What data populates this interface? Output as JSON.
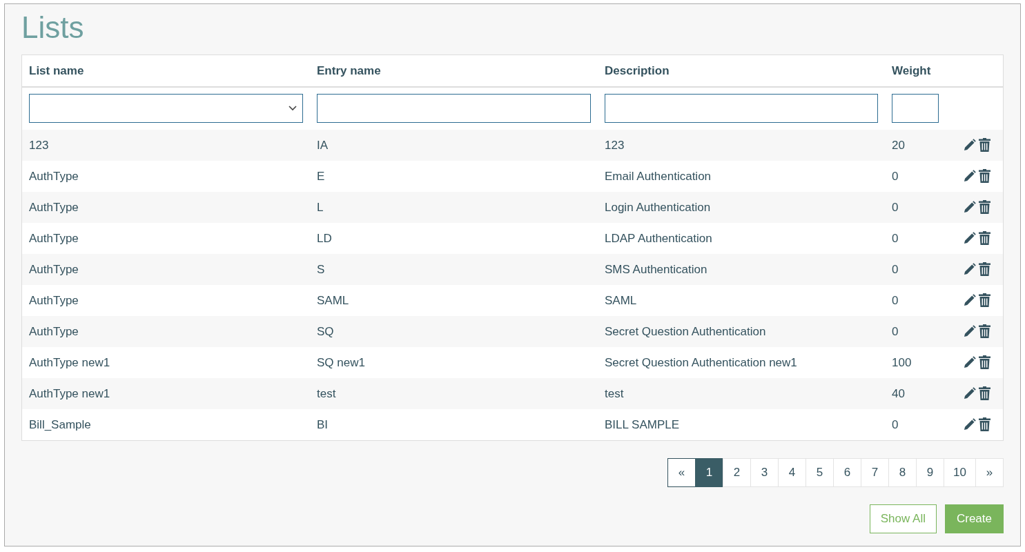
{
  "title": "Lists",
  "table": {
    "columns": [
      "List name",
      "Entry name",
      "Description",
      "Weight"
    ],
    "filters": [
      {
        "kind": "select"
      },
      {
        "kind": "text"
      },
      {
        "kind": "text"
      },
      {
        "kind": "number"
      }
    ],
    "rows": [
      {
        "cells": [
          "123",
          "IA",
          "123",
          "20"
        ]
      },
      {
        "cells": [
          "AuthType",
          "E",
          "Email Authentication",
          "0"
        ]
      },
      {
        "cells": [
          "AuthType",
          "L",
          "Login Authentication",
          "0"
        ]
      },
      {
        "cells": [
          "AuthType",
          "LD",
          "LDAP Authentication",
          "0"
        ]
      },
      {
        "cells": [
          "AuthType",
          "S",
          "SMS Authentication",
          "0"
        ]
      },
      {
        "cells": [
          "AuthType",
          "SAML",
          "SAML",
          "0"
        ]
      },
      {
        "cells": [
          "AuthType",
          "SQ",
          "Secret Question Authentication",
          "0"
        ]
      },
      {
        "cells": [
          "AuthType new1",
          "SQ new1",
          "Secret Question Authentication new1",
          "100"
        ]
      },
      {
        "cells": [
          "AuthType new1",
          "test",
          "test",
          "40"
        ]
      },
      {
        "cells": [
          "Bill_Sample",
          "BI",
          "BILL SAMPLE",
          "0"
        ]
      }
    ]
  },
  "pagination": {
    "previous": "«",
    "next": "»",
    "pages": [
      {
        "label": "1",
        "selected": true
      },
      {
        "label": "2",
        "selected": false
      },
      {
        "label": "3",
        "selected": false
      },
      {
        "label": "4",
        "selected": false
      },
      {
        "label": "5",
        "selected": false
      },
      {
        "label": "6",
        "selected": false
      },
      {
        "label": "7",
        "selected": false
      },
      {
        "label": "8",
        "selected": false
      },
      {
        "label": "9",
        "selected": false
      },
      {
        "label": "10",
        "selected": false
      }
    ]
  },
  "buttons": [
    {
      "label": "Show All",
      "kind": "outline"
    },
    {
      "label": "Create",
      "kind": "solid"
    }
  ]
}
